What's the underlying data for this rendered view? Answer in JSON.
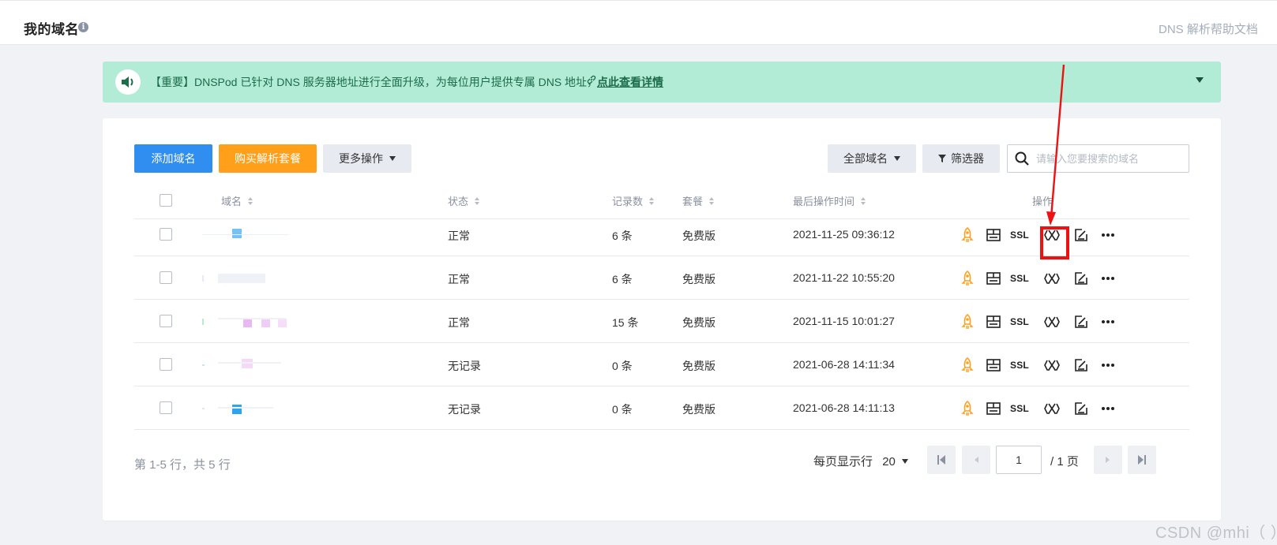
{
  "header": {
    "title": "我的域名",
    "info_icon": "info-icon",
    "help_link": "DNS 解析帮助文档"
  },
  "notice": {
    "text": "【重要】DNSPod 已针对 DNS 服务器地址进行全面升级，为每位用户提供专属 DNS 地址，",
    "link": "点此查看详情",
    "icon": "speaker-icon",
    "color": "#b3ecd6"
  },
  "toolbar": {
    "add_label": "添加域名",
    "buy_label": "购买解析套餐",
    "more_label": "更多操作",
    "all_label": "全部域名",
    "filter_label": "筛选器",
    "search_placeholder": "请输入您要搜索的域名"
  },
  "colors": {
    "primary": "#2f8ef0",
    "warning": "#ff9f1a",
    "annotation": "#ee1111",
    "rocket": "#ff9f1a"
  },
  "table": {
    "columns": {
      "domain": "域名",
      "status": "状态",
      "records": "记录数",
      "plan": "套餐",
      "last_op": "最后操作时间",
      "actions": "操作"
    },
    "rows": [
      {
        "domain": "",
        "status": "正常",
        "records": "6 条",
        "plan": "免费版",
        "last_op": "2021-11-25 09:36:12"
      },
      {
        "domain": "",
        "status": "正常",
        "records": "6 条",
        "plan": "免费版",
        "last_op": "2021-11-22 10:55:20"
      },
      {
        "domain": "",
        "status": "正常",
        "records": "15 条",
        "plan": "免费版",
        "last_op": "2021-11-15 10:01:27"
      },
      {
        "domain": "",
        "status": "无记录",
        "records": "0 条",
        "plan": "免费版",
        "last_op": "2021-06-28 14:11:34"
      },
      {
        "domain": "",
        "status": "无记录",
        "records": "0 条",
        "plan": "免费版",
        "last_op": "2021-06-28 14:11:13"
      }
    ],
    "action_icons": [
      "rocket-icon",
      "dashboard-icon",
      "ssl-icon",
      "link-icon",
      "edit-icon",
      "more-icon"
    ],
    "ssl_label": "SSL"
  },
  "pagination": {
    "summary": "第 1-5 行，共 5 行",
    "per_page_label": "每页显示行",
    "per_page_value": "20",
    "current_page": "1",
    "total_label": "/ 1 页"
  },
  "watermark": "CSDN @mhi（ ）"
}
